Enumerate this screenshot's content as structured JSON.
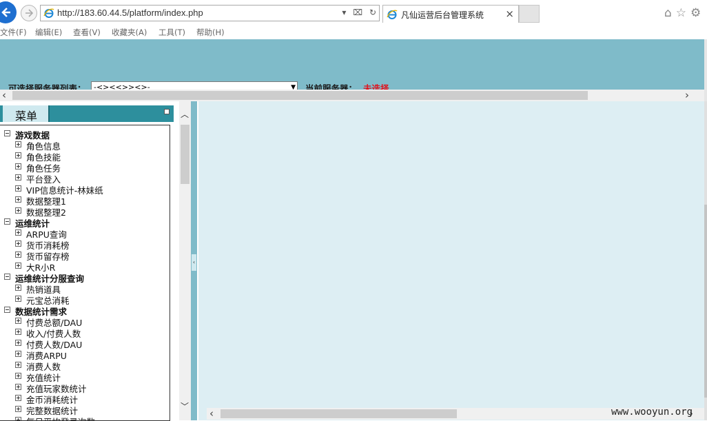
{
  "browser": {
    "url": "http://183.60.44.5/platform/index.php",
    "tab_title": "凡仙运营后台管理系统",
    "tab_close": "×",
    "menu": [
      "文件(F)",
      "编辑(E)",
      "查看(V)",
      "收藏夹(A)",
      "工具(T)",
      "帮助(H)"
    ]
  },
  "header": {
    "server_list_label": "可选择服务器列表：",
    "server_select_value": "-<><<>><>-",
    "current_server_label": "当前服务器：",
    "current_server_value": "未选择",
    "current_server_color": "#e0141e"
  },
  "menu": {
    "title": "菜单",
    "tree": [
      {
        "type": "group",
        "label": "游戏数据"
      },
      {
        "type": "leaf",
        "label": "角色信息"
      },
      {
        "type": "leaf",
        "label": "角色技能"
      },
      {
        "type": "leaf",
        "label": "角色任务"
      },
      {
        "type": "leaf",
        "label": "平台登入"
      },
      {
        "type": "leaf",
        "label": "VIP信息统计-林妹纸"
      },
      {
        "type": "leaf",
        "label": "数据整理1"
      },
      {
        "type": "leaf",
        "label": "数据整理2"
      },
      {
        "type": "group",
        "label": "运维统计"
      },
      {
        "type": "leaf",
        "label": "ARPU查询"
      },
      {
        "type": "leaf",
        "label": "货币消耗榜"
      },
      {
        "type": "leaf",
        "label": "货币留存榜"
      },
      {
        "type": "leaf",
        "label": "大R小R"
      },
      {
        "type": "group",
        "label": "运维统计分服查询"
      },
      {
        "type": "leaf",
        "label": "热销道具"
      },
      {
        "type": "leaf",
        "label": "元宝总消耗"
      },
      {
        "type": "group",
        "label": "数据统计需求"
      },
      {
        "type": "leaf",
        "label": "付费总额/DAU"
      },
      {
        "type": "leaf",
        "label": "收入/付费人数"
      },
      {
        "type": "leaf",
        "label": "付费人数/DAU"
      },
      {
        "type": "leaf",
        "label": "消费ARPU"
      },
      {
        "type": "leaf",
        "label": "消费人数"
      },
      {
        "type": "leaf",
        "label": "充值统计"
      },
      {
        "type": "leaf",
        "label": "充值玩家数统计"
      },
      {
        "type": "leaf",
        "label": "金币消耗统计"
      },
      {
        "type": "leaf",
        "label": "完整数据统计"
      },
      {
        "type": "leaf",
        "label": "每日平均登录次数"
      }
    ]
  },
  "colors": {
    "header_band": "#7fbbc9",
    "menu_head": "#2d8f9d",
    "content_bg": "#ddeef3"
  },
  "watermark": "www.wooyun.org"
}
